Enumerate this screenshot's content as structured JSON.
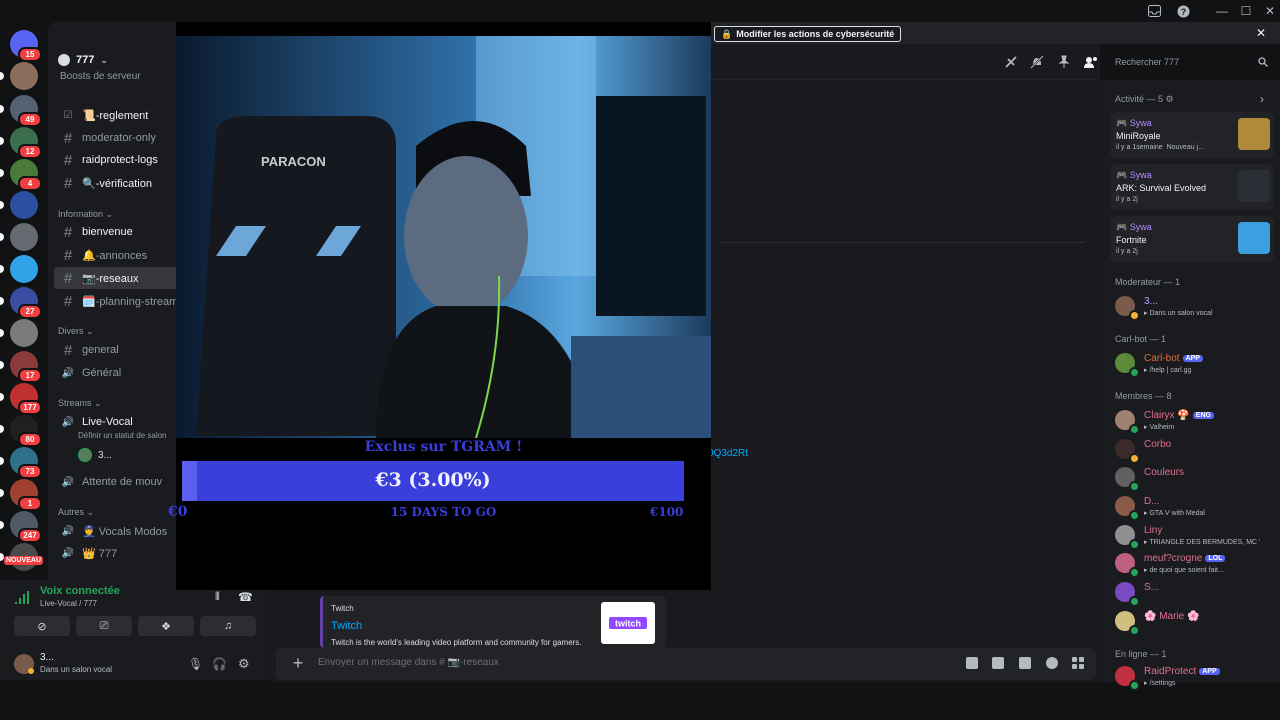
{
  "server": {
    "name": "777",
    "boost_text": "Boosts de serveur"
  },
  "notice": {
    "button_label": "Modifier les actions de cybersécurité"
  },
  "rail": {
    "servers": [
      {
        "icon": "discord-home-icon",
        "badge": "15",
        "color": "#5865f2"
      },
      {
        "icon": "server-icon",
        "badge": "",
        "color": "#8a6d5a"
      },
      {
        "icon": "server-icon",
        "badge": "49",
        "color": "#556070"
      },
      {
        "icon": "server-icon",
        "badge": "12",
        "color": "#3b6e4d"
      },
      {
        "icon": "server-icon",
        "badge": "4",
        "color": "#4a7a3a"
      },
      {
        "icon": "server-icon",
        "badge": "",
        "color": "#2d4fa0"
      },
      {
        "icon": "server-icon",
        "badge": "",
        "color": "#666a70"
      },
      {
        "icon": "server-icon",
        "badge": "",
        "color": "#2fa3e6"
      },
      {
        "icon": "server-icon",
        "badge": "27",
        "color": "#3a4da0"
      },
      {
        "icon": "server-icon",
        "badge": "",
        "color": "#7a7a7a"
      },
      {
        "icon": "server-icon",
        "badge": "17",
        "color": "#8a3a3a"
      },
      {
        "icon": "server-icon",
        "badge": "177",
        "color": "#c03030"
      },
      {
        "icon": "server-icon",
        "badge": "80",
        "color": "#202020"
      },
      {
        "icon": "server-icon",
        "badge": "73",
        "color": "#30708a"
      },
      {
        "icon": "server-icon",
        "badge": "1",
        "color": "#a04030"
      },
      {
        "icon": "server-icon",
        "badge": "247",
        "color": "#505a66"
      },
      {
        "icon": "server-icon",
        "badge": "",
        "color": "#4a4a4a"
      }
    ],
    "new_label": "NOUVEAU"
  },
  "channels": {
    "top": [
      {
        "name": "📜-reglement",
        "icon": "rules-icon"
      },
      {
        "name": "moderator-only",
        "icon": "hash-icon"
      },
      {
        "name": "raidprotect-logs",
        "icon": "hash-icon"
      },
      {
        "name": "🔍-vérification",
        "icon": "hash-icon"
      }
    ],
    "cat_information": "Information",
    "information": [
      {
        "name": "bienvenue"
      },
      {
        "name": "🔔-annonces"
      },
      {
        "name": "📷-reseaux"
      },
      {
        "name": "🗓️-planning-streams"
      }
    ],
    "cat_divers": "Divers",
    "divers": [
      {
        "name": "general",
        "icon": "hash-icon"
      },
      {
        "name": "Général",
        "icon": "speaker-icon"
      }
    ],
    "cat_streams": "Streams",
    "live_vocal": "Live-Vocal",
    "live_vocal_status": "Définir un statut de salon",
    "live_vocal_user": "3...",
    "waiting": "Attente de mouv",
    "cat_autres": "Autres",
    "autres": [
      {
        "name": "👮 Vocals Modos"
      },
      {
        "name": "👑 777"
      }
    ]
  },
  "voice": {
    "title": "Voix connectée",
    "subtitle": "Live-Vocal / 777",
    "user_name": "3...",
    "user_status": "Dans un salon vocal"
  },
  "stream": {
    "headline": "Exclus sur TGRAM !",
    "amount": "€3 (3.00%)",
    "min": "€0",
    "days": "15 DAYS TO GO",
    "max": "€100",
    "progress": 0.03
  },
  "chat": {
    "link_fragment": "0Q3d2Rt",
    "embed_provider": "Twitch",
    "embed_title": "Twitch",
    "embed_desc": "Twitch is the world's leading video platform and community for gamers.",
    "placeholder": "Envoyer un message dans # 📷-reseaux"
  },
  "search": {
    "placeholder": "Rechercher 777"
  },
  "members": {
    "activity_header": "Activité — 5",
    "activities": [
      {
        "user": "Sywa",
        "game": "MiniRoyale",
        "time": "il y a 1semaine",
        "extra": "Nouveau j...",
        "thumb_color": "#b08a3a"
      },
      {
        "user": "Sywa",
        "game": "ARK: Survival Evolved",
        "time": "il y a 2j",
        "extra": "",
        "thumb_color": "#2a2d33"
      },
      {
        "user": "Sywa",
        "game": "Fortnite",
        "time": "il y a 2j",
        "extra": "",
        "thumb_color": "#3aa0e0"
      }
    ],
    "moderator_header": "Moderateur — 1",
    "moderators": [
      {
        "name": "3...",
        "sub": "Dans un salon vocal",
        "color": "#c0a0ff",
        "av": "#7a5a4a",
        "status": "#f0b232"
      }
    ],
    "bot_header": "Carl-bot — 1",
    "bots": [
      {
        "name": "Carl-bot",
        "sub": "/help | carl.gg",
        "color": "#e06c3a",
        "av": "#5a8a3a",
        "status": "#23a55a",
        "tag": "APP"
      }
    ],
    "members_header": "Membres — 8",
    "members": [
      {
        "name": "Clairyx 🍄",
        "sub": "Valheim",
        "color": "#e07090",
        "av": "#a08070",
        "status": "#23a55a",
        "tag": "ENG"
      },
      {
        "name": "Corbo",
        "sub": "",
        "color": "#e07090",
        "av": "#3a2a2a",
        "status": "#f0b232",
        "tag": ""
      },
      {
        "name": "Couleurs",
        "sub": "",
        "color": "#e07090",
        "av": "#606060",
        "status": "#23a55a",
        "tag": ""
      },
      {
        "name": "D...",
        "sub": "GTA V with Medal",
        "color": "#e07090",
        "av": "#8a5a4a",
        "status": "#23a55a",
        "tag": ""
      },
      {
        "name": "Liny",
        "sub": "TRIANGLE DES BERMUDES, MC '",
        "color": "#e07090",
        "av": "#909090",
        "status": "#23a55a",
        "tag": ""
      },
      {
        "name": "meuf?crogne",
        "sub": "de quoi que soient fait...",
        "color": "#e07090",
        "av": "#c06080",
        "status": "#23a55a",
        "tag": "LOL"
      },
      {
        "name": "S...",
        "sub": "",
        "color": "#e07090",
        "av": "#7a4ac0",
        "status": "#23a55a",
        "tag": ""
      },
      {
        "name": "🌸 Marie 🌸",
        "sub": "",
        "color": "#e07090",
        "av": "#d0c080",
        "status": "#23a55a",
        "tag": ""
      }
    ],
    "online_header": "En ligne — 1",
    "online": [
      {
        "name": "RaidProtect",
        "sub": "/settings",
        "color": "#e07090",
        "av": "#c03040",
        "status": "#23a55a",
        "tag": "APP"
      }
    ]
  }
}
